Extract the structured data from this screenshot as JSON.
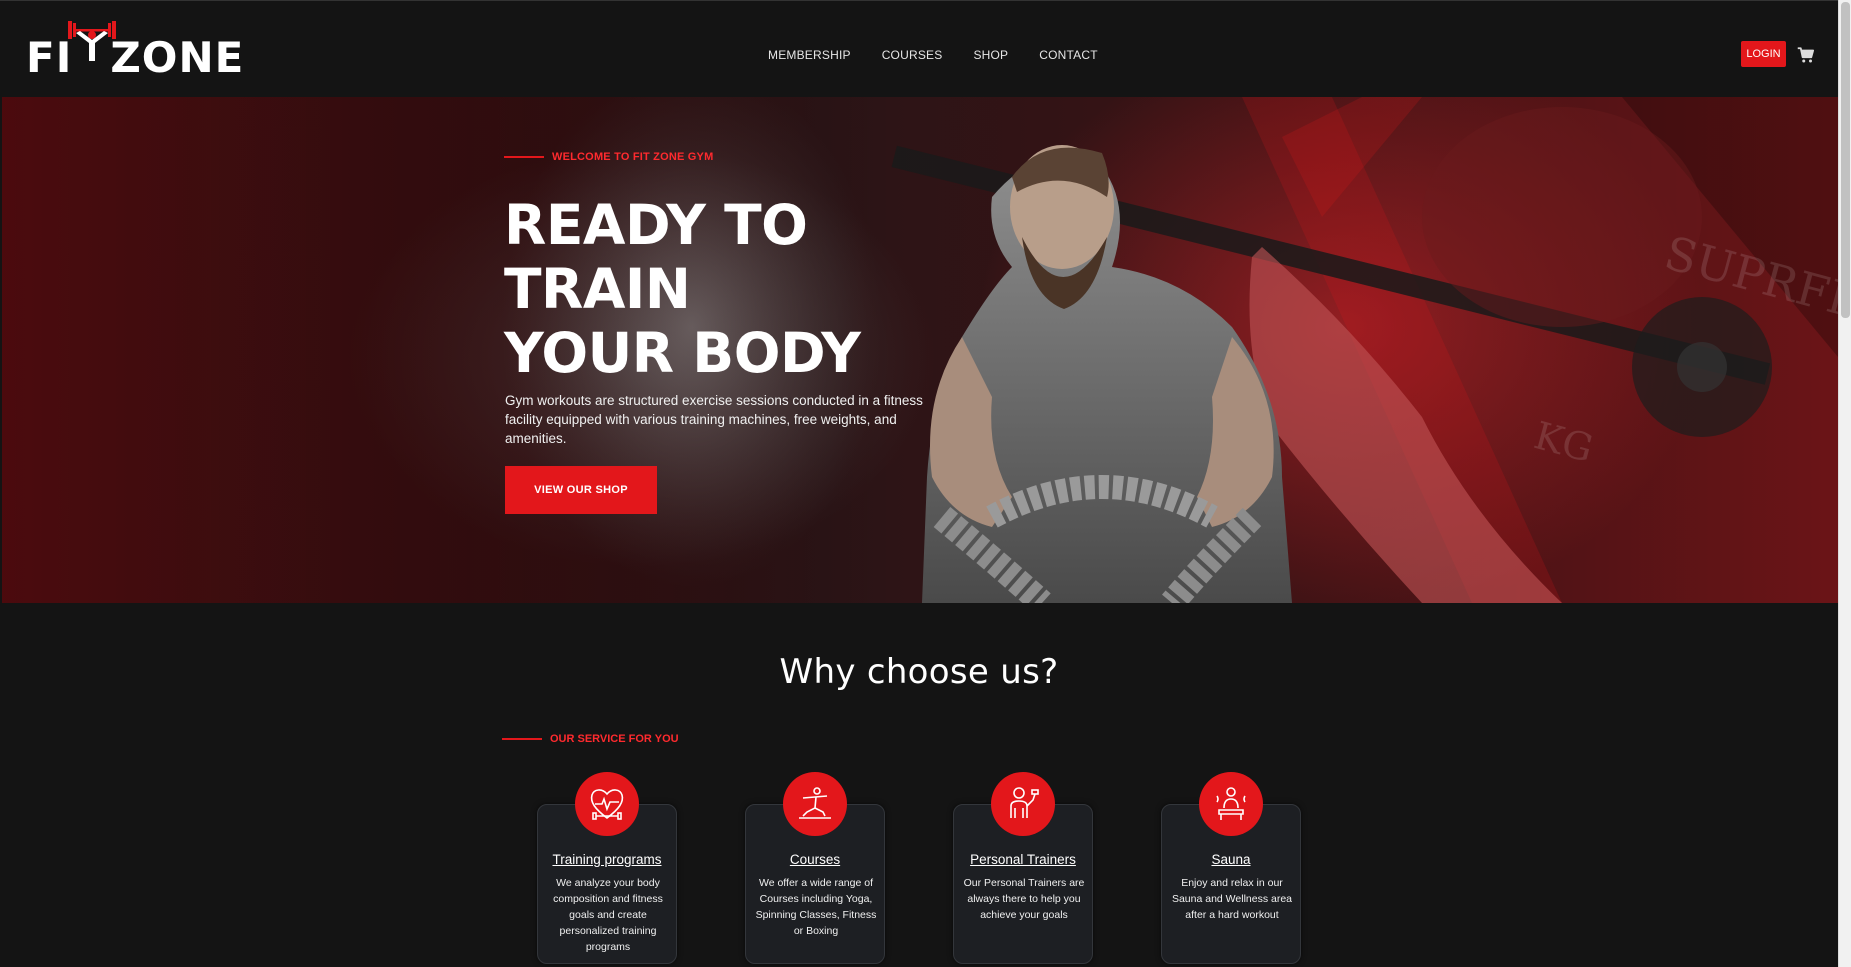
{
  "brand": {
    "logo_text_left": "FI",
    "logo_text_right": "ZONE",
    "accent_color": "#e3171b"
  },
  "nav": {
    "items": [
      "MEMBERSHIP",
      "COURSES",
      "SHOP",
      "CONTACT"
    ],
    "login_label": "LOGIN",
    "cart_icon": "shopping-cart-icon"
  },
  "hero": {
    "eyebrow": "WELCOME TO FIT ZONE GYM",
    "title_lines": [
      "READY TO",
      "TRAIN",
      "YOUR BODY"
    ],
    "description": "Gym workouts are structured exercise sessions conducted in a fitness facility equipped with various training machines, free weights, and amenities.",
    "cta_label": "VIEW OUR SHOP"
  },
  "why": {
    "title": "Why choose us?",
    "eyebrow": "OUR SERVICE FOR YOU",
    "services": [
      {
        "icon": "heart-dumbbell-icon",
        "title": "Training programs",
        "text": "We analyze your body composition and fitness goals and create personalized training programs"
      },
      {
        "icon": "yoga-pose-icon",
        "title": "Courses",
        "text": "We offer a wide range of Courses including Yoga, Spinning Classes, Fitness or Boxing"
      },
      {
        "icon": "personal-trainer-icon",
        "title": "Personal Trainers",
        "text": "Our Personal Trainers are always there to help you achieve your goals"
      },
      {
        "icon": "sauna-icon",
        "title": "Sauna",
        "text": "Enjoy and relax in our Sauna and Wellness area after a hard workout"
      }
    ]
  }
}
